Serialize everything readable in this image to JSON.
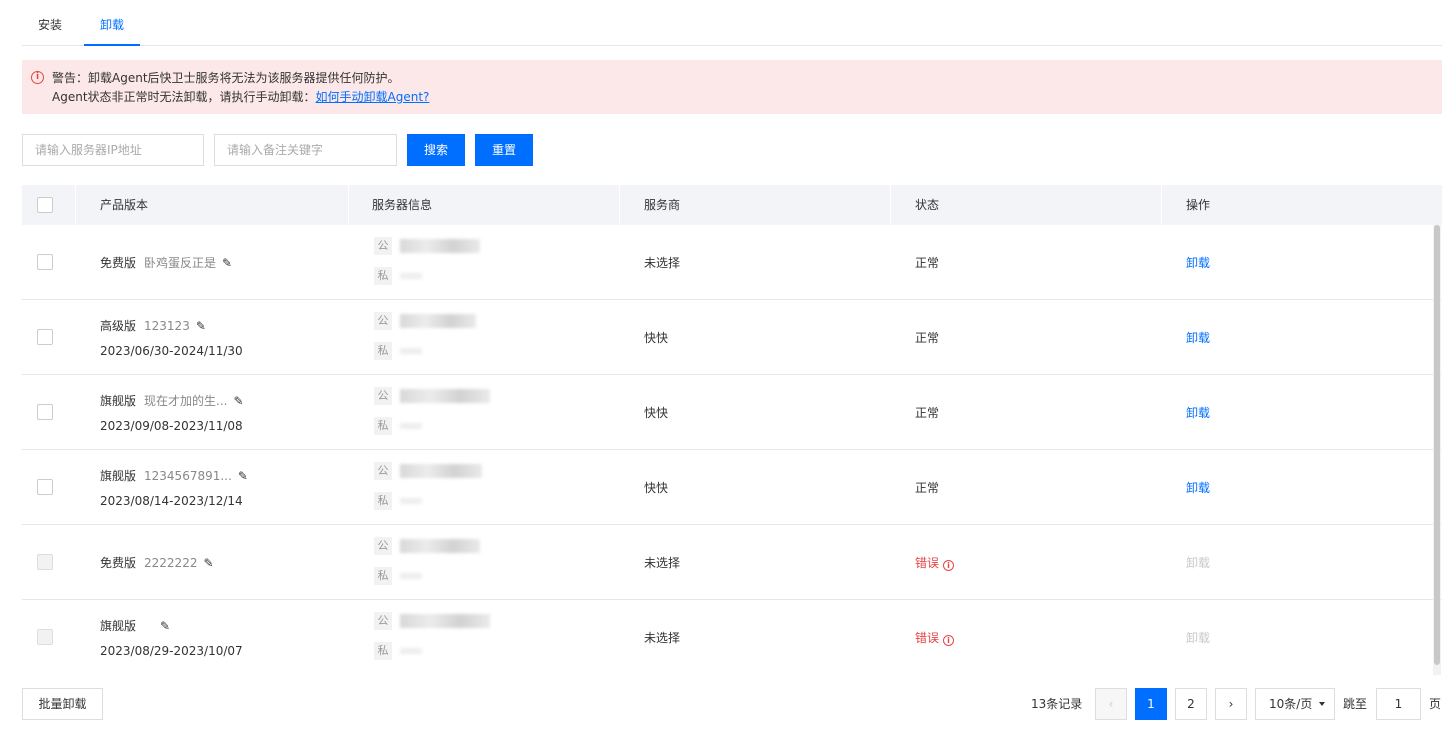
{
  "tabs": [
    {
      "label": "安装",
      "active": false
    },
    {
      "label": "卸载",
      "active": true
    }
  ],
  "alert": {
    "line1": "警告：卸载Agent后快卫士服务将无法为该服务器提供任何防护。",
    "line2_prefix": "Agent状态非正常时无法卸载，请执行手动卸载：",
    "line2_link": "如何手动卸载Agent?",
    "icon": "info-circle-icon",
    "color": "#e54545",
    "background": "#fce8e8"
  },
  "filters": {
    "ip_placeholder": "请输入服务器IP地址",
    "note_placeholder": "请输入备注关键字",
    "search_label": "搜索",
    "reset_label": "重置"
  },
  "table": {
    "columns": [
      "产品版本",
      "服务器信息",
      "服务商",
      "状态",
      "操作"
    ],
    "ip_tags": {
      "public": "公",
      "private": "私"
    },
    "rows": [
      {
        "edition": "免费版",
        "note": "卧鸡蛋反正是",
        "date": "",
        "provider": "未选择",
        "status": "正常",
        "status_error": false,
        "action": "卸载",
        "disabled": false
      },
      {
        "edition": "高级版",
        "note": "123123",
        "date": "2023/06/30-2024/11/30",
        "provider": "快快",
        "status": "正常",
        "status_error": false,
        "action": "卸载",
        "disabled": false
      },
      {
        "edition": "旗舰版",
        "note": "现在才加的生...",
        "date": "2023/09/08-2023/11/08",
        "provider": "快快",
        "status": "正常",
        "status_error": false,
        "action": "卸载",
        "disabled": false
      },
      {
        "edition": "旗舰版",
        "note": "1234567891...",
        "date": "2023/08/14-2023/12/14",
        "provider": "快快",
        "status": "正常",
        "status_error": false,
        "action": "卸载",
        "disabled": false
      },
      {
        "edition": "免费版",
        "note": "2222222",
        "date": "",
        "provider": "未选择",
        "status": "错误",
        "status_error": true,
        "action": "卸载",
        "disabled": true
      },
      {
        "edition": "旗舰版",
        "note": "",
        "date": "2023/08/29-2023/10/07",
        "provider": "未选择",
        "status": "错误",
        "status_error": true,
        "action": "卸载",
        "disabled": true
      }
    ]
  },
  "footer": {
    "batch_uninstall": "批量卸载",
    "total": "13条记录",
    "prev": "‹",
    "next": "›",
    "pages": [
      "1",
      "2"
    ],
    "current_page": "1",
    "page_size": "10条/页",
    "jump_to": "跳至",
    "jump_value": "1",
    "page_unit": "页"
  },
  "colors": {
    "accent": "#006eff",
    "error": "#e54545",
    "header_bg": "#f2f4f7"
  }
}
